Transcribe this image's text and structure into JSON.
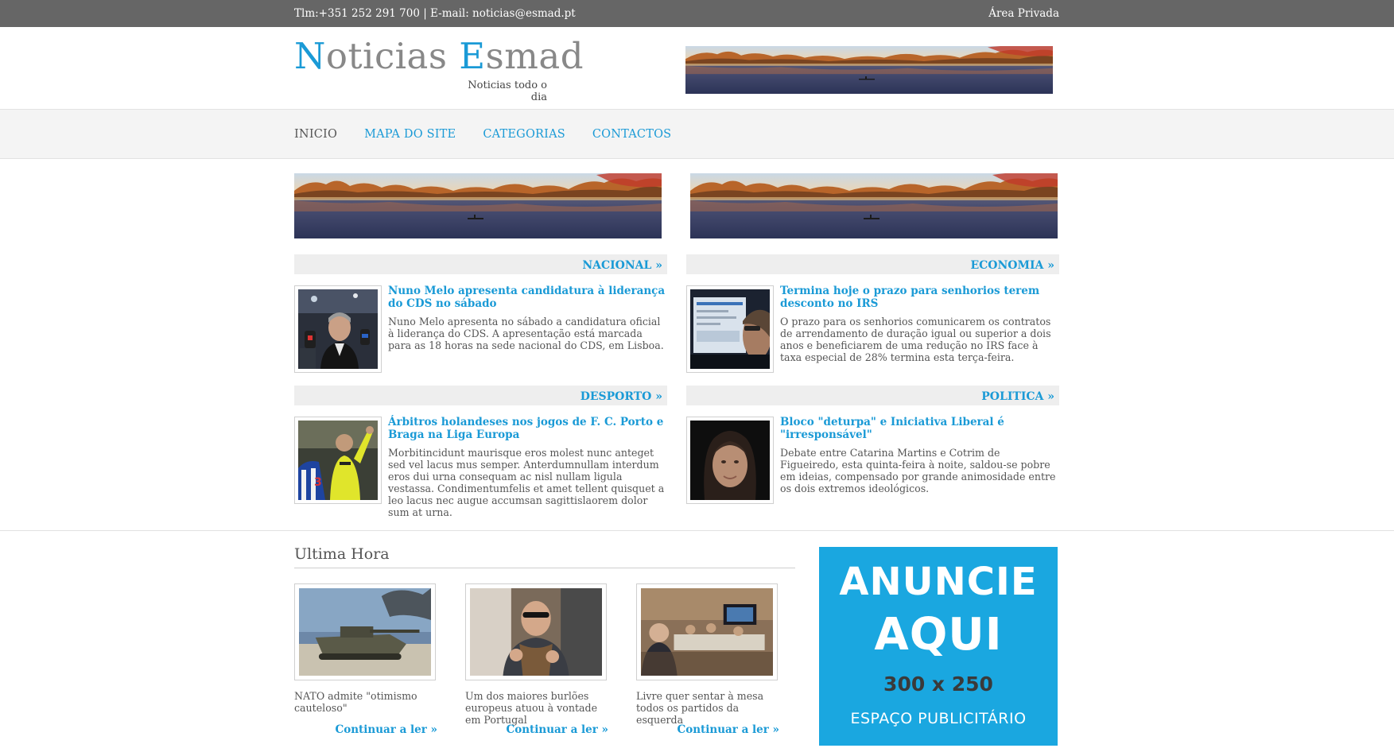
{
  "topbar": {
    "contact": "Tlm:+351 252 291 700 | E-mail: noticias@esmad.pt",
    "private_area": "Área Privada"
  },
  "header": {
    "logo_n": "N",
    "logo_rest1": "oticias ",
    "logo_e": "E",
    "logo_rest2": "smad",
    "tagline": "Noticias todo o dia"
  },
  "nav": {
    "items": [
      {
        "label": "INICIO"
      },
      {
        "label": "MAPA DO SITE"
      },
      {
        "label": "CATEGORIAS"
      },
      {
        "label": "CONTACTOS"
      }
    ]
  },
  "categories": [
    {
      "name": "NACIONAL »",
      "title": "Nuno Melo apresenta candidatura à liderança do CDS no sábado",
      "desc": "Nuno Melo apresenta no sábado a candidatura oficial à liderança do CDS. A apresentação está marcada para as 18 horas na sede nacional do CDS, em Lisboa."
    },
    {
      "name": "ECONOMIA »",
      "title": "Termina hoje o prazo para senhorios terem desconto no IRS",
      "desc": "O prazo para os senhorios comunicarem os contratos de arrendamento de duração igual ou superior a dois anos e beneficiarem de uma redução no IRS face à taxa especial de 28% termina esta terça-feira."
    },
    {
      "name": "DESPORTO »",
      "title": "Árbitros holandeses nos jogos de F. C. Porto e Braga na Liga Europa",
      "desc": "Morbitincidunt maurisque eros molest nunc anteget sed vel lacus mus semper. Anterdumnullam interdum eros dui urna consequam ac nisl nullam ligula vestassa. Condimentumfelis et amet tellent quisquet a leo lacus nec augue accumsan sagittislaorem dolor sum at urna."
    },
    {
      "name": "POLITICA »",
      "title": "Bloco \"deturpa\" e Iniciativa Liberal é \"irresponsável\"",
      "desc": "Debate entre Catarina Martins e Cotrim de Figueiredo, esta quinta-feira à noite, saldou-se pobre em ideias, compensado por grande animosidade entre os dois extremos ideológicos."
    }
  ],
  "ultima": {
    "heading": "Ultima Hora",
    "items": [
      {
        "caption": "NATO admite \"otimismo cauteloso\"",
        "more": "Continuar a ler »"
      },
      {
        "caption": "Um dos maiores burlões europeus atuou à vontade em Portugal",
        "more": "Continuar a ler »"
      },
      {
        "caption": "Livre quer sentar à mesa todos os partidos da esquerda",
        "more": "Continuar a ler »"
      }
    ]
  },
  "ad": {
    "line1": "ANUNCIE",
    "line2": "AQUI",
    "line3": "300 x 250",
    "line4": "ESPAÇO PUBLICITÁRIO"
  },
  "colors": {
    "accent": "#1a9ad6",
    "topbar": "#666666",
    "ad_bg": "#1aa7e0"
  }
}
